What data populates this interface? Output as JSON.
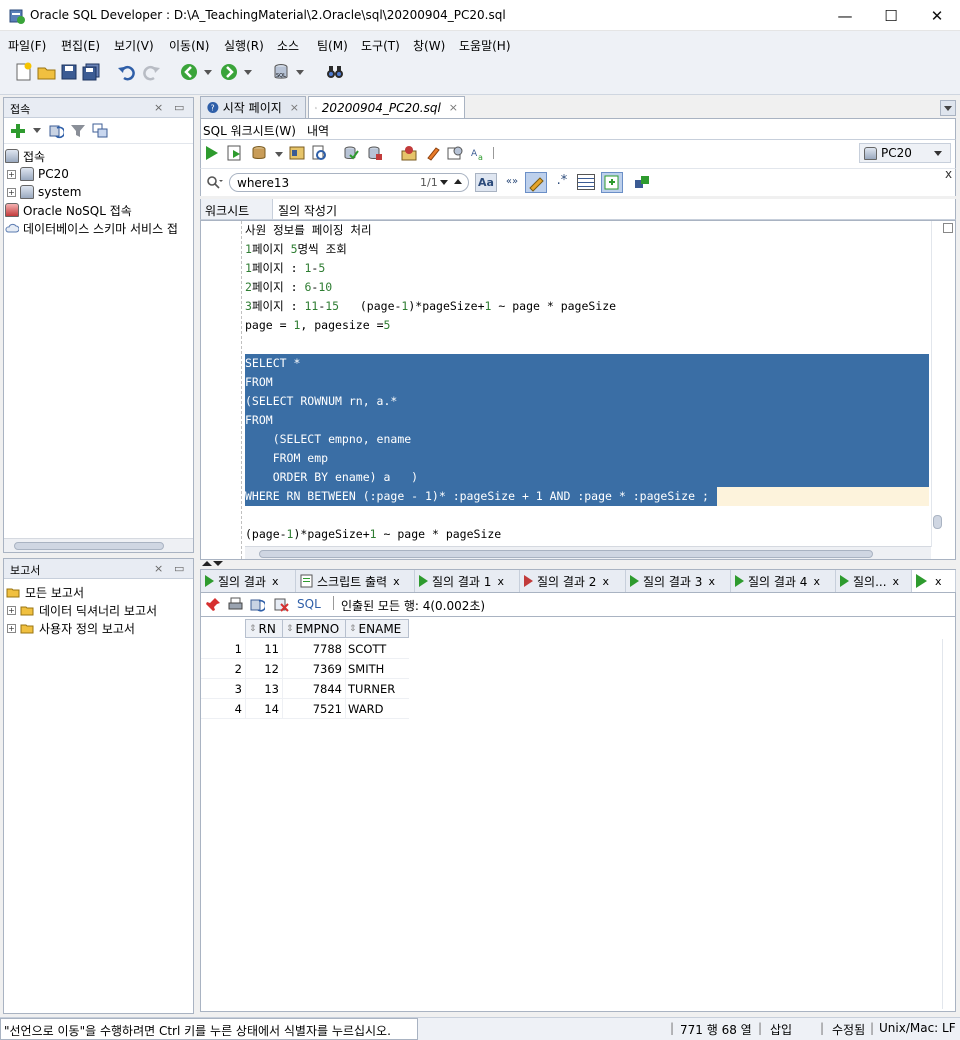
{
  "window": {
    "title": "Oracle SQL Developer : D:\\A_TeachingMaterial\\2.Oracle\\sql\\20200904_PC20.sql",
    "minimize": "—",
    "maximize": "☐",
    "close": "✕"
  },
  "menu": [
    "파일(F)",
    "편집(E)",
    "보기(V)",
    "이동(N)",
    "실행(R)",
    "소스",
    "팀(M)",
    "도구(T)",
    "창(W)",
    "도움말(H)"
  ],
  "connections_panel": {
    "title": "접속",
    "root": "접속",
    "items": [
      "PC20",
      "system"
    ],
    "nosql": "Oracle NoSQL 접속",
    "schema_service": "데이터베이스 스키마 서비스 접"
  },
  "reports_panel": {
    "title": "보고서",
    "items": [
      "모든 보고서",
      "데이터 딕셔너리 보고서",
      "사용자 정의 보고서"
    ]
  },
  "doc_tabs": [
    {
      "label": "시작 페이지"
    },
    {
      "label": "20200904_PC20.sql"
    }
  ],
  "editor_subtabs": [
    "SQL 워크시트(W)",
    "내역"
  ],
  "connection_select": "PC20",
  "search": {
    "value": "where13",
    "count": "1/1"
  },
  "worksheet_tabs": [
    "워크시트",
    "질의 작성기"
  ],
  "code_lines": [
    {
      "text": "사원 정보를 페이징 처리",
      "sel": false
    },
    {
      "text": "1페이지 5명씩 조회",
      "sel": false
    },
    {
      "text": "1페이지 : 1-5",
      "sel": false
    },
    {
      "text": "2페이지 : 6-10",
      "sel": false
    },
    {
      "text": "3페이지 : 11-15   (page-1)*pageSize+1 ~ page * pageSize",
      "sel": false
    },
    {
      "text": "page = 1, pagesize =5",
      "sel": false
    },
    {
      "text": "",
      "sel": false
    },
    {
      "text": "SELECT *",
      "sel": true
    },
    {
      "text": "FROM",
      "sel": true
    },
    {
      "text": "(SELECT ROWNUM rn, a.*",
      "sel": true
    },
    {
      "text": "FROM",
      "sel": true
    },
    {
      "text": "    (SELECT empno, ename",
      "sel": true
    },
    {
      "text": "    FROM emp",
      "sel": true
    },
    {
      "text": "    ORDER BY ename) a   )",
      "sel": true
    },
    {
      "text": "WHERE RN BETWEEN (:page - 1)* :pageSize + 1 AND :page * :pageSize ;",
      "sel": true
    },
    {
      "text": "",
      "sel": false
    },
    {
      "text": "(page-1)*pageSize+1 ~ page * pageSize",
      "sel": false
    }
  ],
  "result_tabs": [
    "질의 결과",
    "스크립트 출력",
    "질의 결과 1",
    "질의 결과 2",
    "질의 결과 3",
    "질의 결과 4",
    "질의..."
  ],
  "result_toolbar": {
    "sql_label": "SQL",
    "fetched": "인출된 모든 행: 4(0.002초)"
  },
  "grid": {
    "columns": [
      "RN",
      "EMPNO",
      "ENAME"
    ],
    "rows": [
      {
        "n": "1",
        "rn": "11",
        "empno": "7788",
        "ename": "SCOTT"
      },
      {
        "n": "2",
        "rn": "12",
        "empno": "7369",
        "ename": "SMITH"
      },
      {
        "n": "3",
        "rn": "13",
        "empno": "7844",
        "ename": "TURNER"
      },
      {
        "n": "4",
        "rn": "14",
        "empno": "7521",
        "ename": "WARD"
      }
    ]
  },
  "status": {
    "message": "\"선언으로 이동\"을 수행하려면 Ctrl 키를 누른 상태에서 식별자를 누르십시오.",
    "position": "771 행 68 열",
    "mode": "삽입",
    "modified": "수정됨",
    "eol": "Unix/Mac: LF"
  },
  "colors": {
    "selection": "#3a6ea5",
    "current_line": "#fdf3dc",
    "number": "#2e7d32",
    "run_green": "#2e9b2e"
  }
}
